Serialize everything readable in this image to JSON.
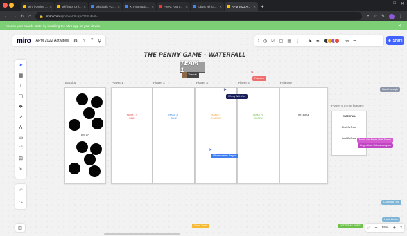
{
  "browser": {
    "tabs": [
      {
        "title": "Miro | Online Whiteboard",
        "favicon_color": "#f9c300",
        "active": false
      },
      {
        "title": "self intro, Online Whitebo...",
        "favicon_color": "#f9c300",
        "active": false
      },
      {
        "title": "principals - Google Search",
        "favicon_color": "#4285f4",
        "active": false
      },
      {
        "title": "XIT-manoplanned - Goo...",
        "favicon_color": "#4285f4",
        "active": false
      },
      {
        "title": "FINAL FANTASY VII Re...",
        "favicon_color": "#e53935",
        "active": false
      },
      {
        "title": "robust vehicle - Google...",
        "favicon_color": "#4285f4",
        "active": false
      },
      {
        "title": "APM 2022 Activities, Onl...",
        "favicon_color": "#f9c300",
        "active": true
      }
    ],
    "new_tab": "+",
    "url_host": "miro.com",
    "url_path": "/app/board/uXjVOFSuB-8=/",
    "icons": [
      "back-icon",
      "forward-icon",
      "reload-icon",
      "home-icon",
      "share-icon",
      "star-icon",
      "extensions-icon",
      "profile-icon",
      "menu-icon"
    ]
  },
  "banner": {
    "prefix": "Access your boards faster by ",
    "link": "installing the Miro app",
    "suffix": " on your device."
  },
  "toolbar": {
    "logo": "miro",
    "board_name": "APM 2022 Activities",
    "collaborator_count": "20",
    "share_label": "Share",
    "avatar_colors": [
      "#333333",
      "#f3a21b",
      "#9b59b6",
      "#e74c3c"
    ]
  },
  "board": {
    "title": "THE PENNY GAME - WATERFALL",
    "team_label": "TEAM 1",
    "team_user": "Thamin",
    "columns": [
      {
        "label": "Backlog",
        "text": "BATCH",
        "text_color": "#444444"
      },
      {
        "label": "Player 1",
        "text": "MAKE IT\nRED",
        "text_color": "#e8534b"
      },
      {
        "label": "Player 2",
        "text": "MAKE IT\nBLUE",
        "text_color": "#3d8fe0"
      },
      {
        "label": "Player 3",
        "text": "MAKE IT\nORANGE",
        "text_color": "#f2a33a"
      },
      {
        "label": "Player 4",
        "text": "MAKE IT\nGREEN",
        "text_color": "#6cc04a"
      },
      {
        "label": "Release",
        "text": "RELEASE",
        "text_color": "#444444"
      }
    ],
    "timekeeper": {
      "label": "Player 5 (Time keeper)",
      "lines": [
        "WATERFALL",
        "First Release",
        "Last Release"
      ]
    }
  },
  "collaborators": [
    {
      "name": "Praveen",
      "color": "#f06d6d"
    },
    {
      "name": "Wong Wei Yan",
      "color": "#1a1f5c"
    },
    {
      "name": "Vikneswaran Segar",
      "color": "#3f7ef0"
    },
    {
      "name": "Hani Hayagih",
      "color": "#8c96a8"
    },
    {
      "name": "Nurul Ain Amira binti Zurian",
      "color": "#d45bd0"
    },
    {
      "name": "Kugenthan Subramaniyam",
      "color": "#c144c5"
    },
    {
      "name": "Charissa Hoo",
      "color": "#7fb5d6"
    },
    {
      "name": "Hanif Aiman",
      "color": "#7fb5d6"
    },
    {
      "name": "Guna Seeh",
      "color": "#f6b82f"
    },
    {
      "name": "XIT SRMS APPS",
      "color": "#6cc04a"
    }
  ],
  "zoom": {
    "level": "55%"
  }
}
